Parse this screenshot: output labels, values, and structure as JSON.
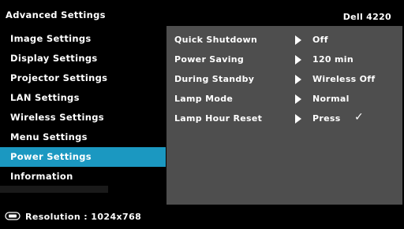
{
  "header": {
    "title": "Advanced Settings",
    "model": "Dell 4220"
  },
  "menu": {
    "items": [
      {
        "label": "Image Settings"
      },
      {
        "label": "Display Settings"
      },
      {
        "label": "Projector Settings"
      },
      {
        "label": "LAN Settings"
      },
      {
        "label": "Wireless Settings"
      },
      {
        "label": "Menu Settings"
      },
      {
        "label": "Power Settings"
      },
      {
        "label": "Information"
      }
    ],
    "selected": "Power Settings"
  },
  "panel": {
    "rows": [
      {
        "label": "Quick Shutdown",
        "value": "Off"
      },
      {
        "label": "Power Saving",
        "value": "120 min"
      },
      {
        "label": "During Standby",
        "value": "Wireless Off"
      },
      {
        "label": "Lamp Mode",
        "value": "Normal"
      },
      {
        "label": "Lamp Hour Reset",
        "value": "Press",
        "mark": "✓"
      }
    ]
  },
  "footer": {
    "source_icon": "video-source-icon",
    "resolution": "Resolution : 1024x768"
  },
  "colors": {
    "background": "#000000",
    "highlight": "#1b98c1",
    "panel": "#4e4e4e",
    "text": "#ffffff"
  }
}
